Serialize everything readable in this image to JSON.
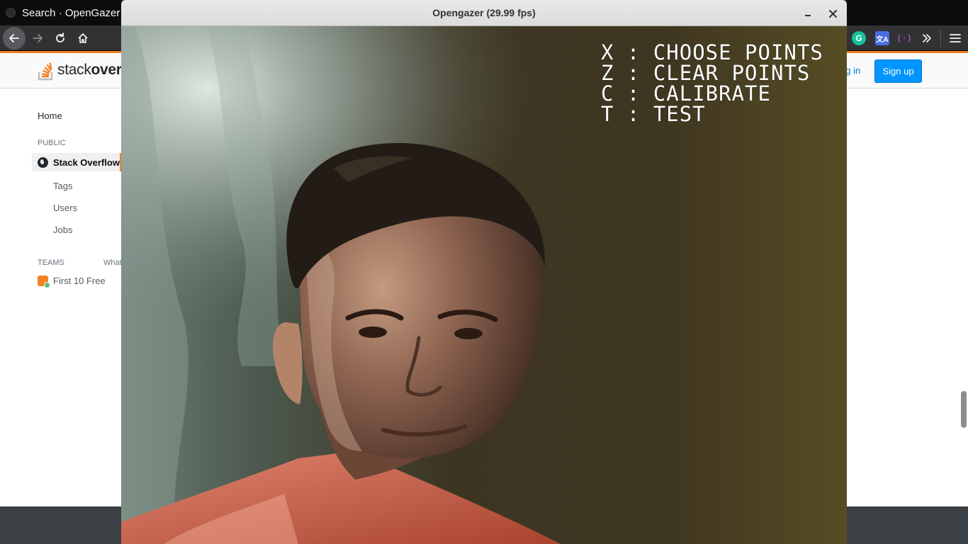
{
  "browser": {
    "tab_title": "Search · OpenGazer",
    "extensions": {
      "grammarly_letter": "G",
      "translate_label": "文A",
      "live_label": "(·)"
    }
  },
  "stackoverflow": {
    "logo_prefix": "stack",
    "logo_bold": "overf",
    "login_label": "og in",
    "signup_label": "Sign up",
    "nav": {
      "home": "Home",
      "public_heading": "PUBLIC",
      "stack_overflow": "Stack Overflow",
      "tags": "Tags",
      "users": "Users",
      "jobs": "Jobs",
      "teams_heading": "TEAMS",
      "whats_this": "What",
      "first_10_free": "First 10 Free"
    },
    "colors": {
      "accent": "#f48024",
      "link": "#0077cc",
      "button": "#0095ff"
    }
  },
  "opengazer": {
    "window_title": "Opengazer (29.99 fps)",
    "overlay_commands": [
      "X : CHOOSE POINTS",
      "Z : CLEAR POINTS",
      "C : CALIBRATE",
      "T : TEST"
    ]
  }
}
